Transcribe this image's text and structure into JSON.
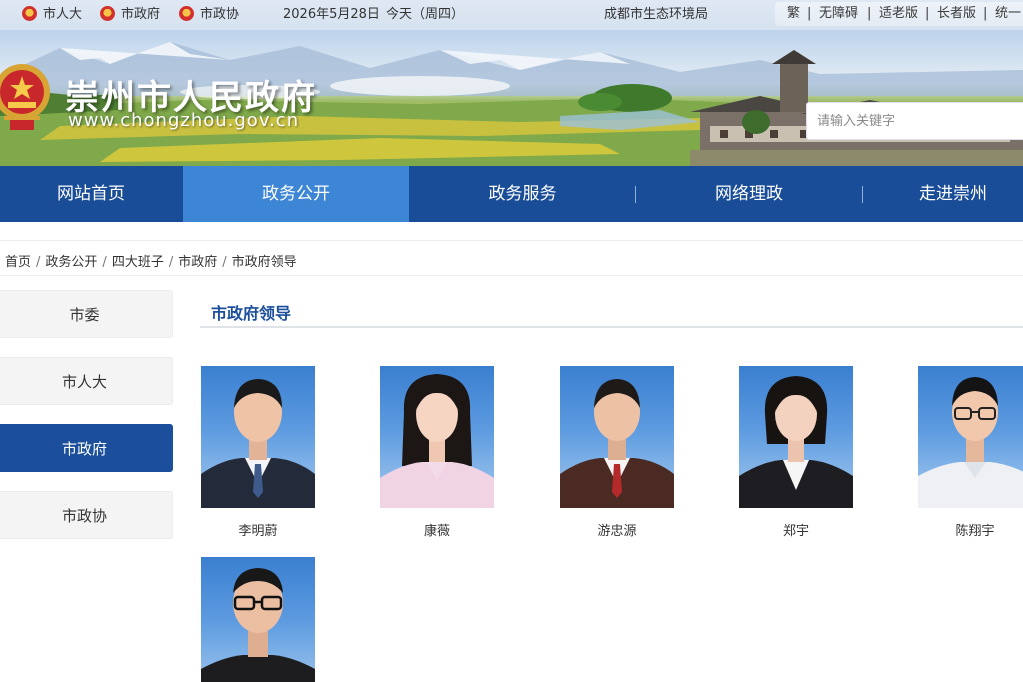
{
  "topbar": {
    "links": [
      "市人大",
      "市政府",
      "市政协"
    ],
    "date": "2026年5月28日",
    "today": "今天（周四）",
    "dept": "成都市生态环境局",
    "tools": [
      "繁",
      "无障碍",
      "适老版",
      "长者版",
      "统一"
    ]
  },
  "site": {
    "title": "崇州市人民政府",
    "url": "www.chongzhou.gov.cn"
  },
  "search": {
    "placeholder": "请输入关键字"
  },
  "nav": [
    "网站首页",
    "政务公开",
    "政务服务",
    "网络理政",
    "走进崇州"
  ],
  "nav_active": "政务公开",
  "breadcrumb": [
    "首页",
    "政务公开",
    "四大班子",
    "市政府",
    "市政府领导"
  ],
  "sidebar": [
    "市委",
    "市人大",
    "市政府",
    "市政协"
  ],
  "sidebar_active": "市政府",
  "section_title": "市政府领导",
  "leaders": [
    {
      "name": "李明蔚"
    },
    {
      "name": "康薇"
    },
    {
      "name": "游忠源"
    },
    {
      "name": "郑宇"
    },
    {
      "name": "陈翔宇"
    },
    {
      "name": ""
    }
  ],
  "colors": {
    "nav": "#1a4d97",
    "nav_active": "#3d86d6",
    "accent": "#1b4f9c"
  }
}
